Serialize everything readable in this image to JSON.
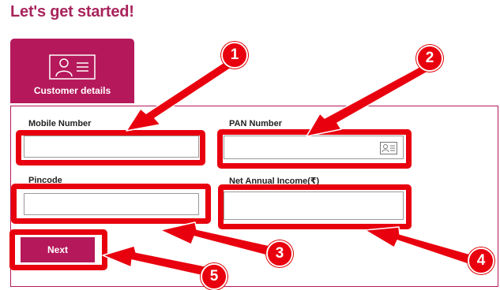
{
  "page": {
    "title": "Let's get started!"
  },
  "step_tab": {
    "label": "Customer details",
    "icon": "id-card-icon"
  },
  "form": {
    "mobile": {
      "label": "Mobile Number",
      "value": ""
    },
    "pan": {
      "label": "PAN Number",
      "value": "",
      "icon": "id-card-icon"
    },
    "pincode": {
      "label": "Pincode",
      "value": ""
    },
    "income": {
      "label": "Net Annual Income(₹)",
      "value": ""
    },
    "next_label": "Next"
  },
  "annotations": {
    "b1": "1",
    "b2": "2",
    "b3": "3",
    "b4": "4",
    "b5": "5"
  },
  "colors": {
    "brand": "#b5195b",
    "highlight": "#e8000e",
    "title": "#a8245c"
  }
}
